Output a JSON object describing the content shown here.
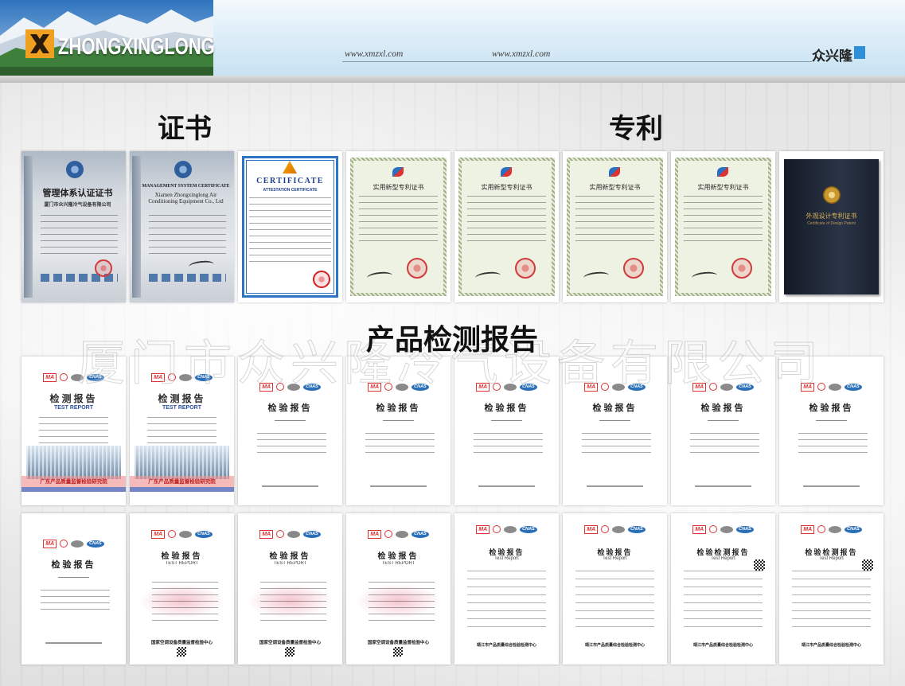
{
  "header": {
    "brand": "ZHONGXINGLONG",
    "url_left": "www.xmzxl.com",
    "url_right": "www.xmzxl.com",
    "brand_cn": "众兴隆"
  },
  "titles": {
    "certificates": "证书",
    "patents": "专利",
    "reports": "产品检测报告"
  },
  "watermark": "厦门市众兴隆冷气设备有限公司",
  "marks": {
    "ma": "MA",
    "cnas": "CNAS"
  },
  "colors": {
    "header_blue": "#cfe6f4",
    "accent_blue": "#2d8fd8",
    "logo_orange": "#f0a020",
    "seal_red": "#d23b3b"
  },
  "row1": [
    {
      "type": "mgmt-cn",
      "title": "管理体系认证证书",
      "company": "厦门市众兴隆冷气设备有限公司"
    },
    {
      "type": "mgmt-en",
      "title": "MANAGEMENT SYSTEM CERTIFICATE",
      "company": "Xiamen Zhongxinglong Air Conditioning Equipment Co., Ltd"
    },
    {
      "type": "ce",
      "title": "CERTIFICATE",
      "subtitle": "ATTESTATION CERTIFICATE"
    },
    {
      "type": "patent",
      "title": "实用新型专利证书"
    },
    {
      "type": "patent",
      "title": "实用新型专利证书"
    },
    {
      "type": "patent",
      "title": "实用新型专利证书"
    },
    {
      "type": "patent",
      "title": "实用新型专利证书"
    },
    {
      "type": "design-book",
      "title": "外观设计专利证书",
      "subtitle": "Certificate of Design Patent"
    }
  ],
  "row2": [
    {
      "type": "report-gd",
      "title": "检测报告",
      "subtitle": "TEST REPORT",
      "org": "广东产品质量监督检验研究院"
    },
    {
      "type": "report-gd",
      "title": "检测报告",
      "subtitle": "TEST REPORT",
      "org": "广东产品质量监督检验研究院"
    },
    {
      "type": "report-cnas",
      "title": "检验报告"
    },
    {
      "type": "report-cnas",
      "title": "检验报告"
    },
    {
      "type": "report-cnas",
      "title": "检验报告"
    },
    {
      "type": "report-cnas",
      "title": "检验报告"
    },
    {
      "type": "report-cnas",
      "title": "检验报告"
    },
    {
      "type": "report-cnas",
      "title": "检验报告"
    }
  ],
  "row3": [
    {
      "type": "report-cnas",
      "title": "检验报告"
    },
    {
      "type": "report-test",
      "title": "检验报告",
      "subtitle": "TEST REPORT",
      "org": "国家空调设备质量监督检验中心"
    },
    {
      "type": "report-test",
      "title": "检验报告",
      "subtitle": "TEST REPORT",
      "org": "国家空调设备质量监督检验中心"
    },
    {
      "type": "report-test",
      "title": "检验报告",
      "subtitle": "TEST REPORT",
      "org": "国家空调设备质量监督检验中心"
    },
    {
      "type": "report-jj",
      "title": "检验报告",
      "subtitle": "Test Report",
      "org": "靖江市产品质量综合检验检测中心"
    },
    {
      "type": "report-jj",
      "title": "检验报告",
      "subtitle": "Test Report",
      "org": "靖江市产品质量综合检验检测中心"
    },
    {
      "type": "report-jc",
      "title": "检验检测报告",
      "subtitle": "Test Report",
      "org": "靖江市产品质量综合检验检测中心"
    },
    {
      "type": "report-jc",
      "title": "检验检测报告",
      "subtitle": "Test Report",
      "org": "靖江市产品质量综合检验检测中心"
    }
  ]
}
